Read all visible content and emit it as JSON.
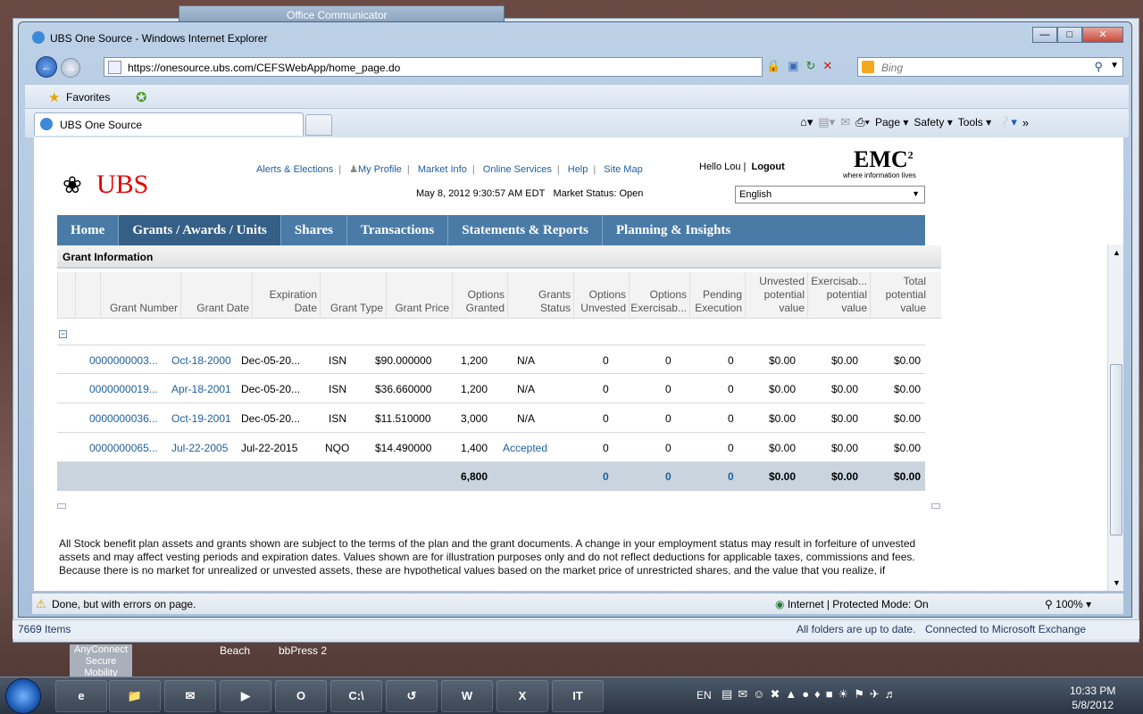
{
  "background_window": {
    "title": "Office Communicator",
    "status_left": "7669 Items",
    "status_mid": "All folders are up to date.",
    "status_right": "Connected to Microsoft Exchange"
  },
  "browser": {
    "title": "UBS One Source - Windows Internet Explorer",
    "url": "https://onesource.ubs.com/CEFSWebApp/home_page.do",
    "search_placeholder": "Bing",
    "favorites_label": "Favorites",
    "tab_label": "UBS One Source",
    "command_bar": [
      "Page",
      "Safety",
      "Tools"
    ],
    "status_message": "Done, but with errors on page.",
    "security_zone": "Internet | Protected Mode: On",
    "zoom": "100%"
  },
  "page": {
    "logo_text": "UBS",
    "top_links": [
      "Alerts & Elections",
      "My Profile",
      "Market Info",
      "Online Services",
      "Help",
      "Site Map"
    ],
    "datetime": "May 8, 2012 9:30:57 AM EDT",
    "market_status": "Market Status: Open",
    "hello": "Hello Lou |",
    "logout": "Logout",
    "emc_logo": "EMC",
    "emc_sup": "2",
    "emc_tagline": "where information lives",
    "language": "English",
    "nav": [
      "Home",
      "Grants / Awards / Units",
      "Shares",
      "Transactions",
      "Statements & Reports",
      "Planning & Insights"
    ],
    "active_nav": "Grants / Awards / Units",
    "section_title": "Grant Information",
    "columns": [
      "Grant Number",
      "Grant Date",
      "Expiration Date",
      "Grant Type",
      "Grant Price",
      "Options Granted",
      "Grants Status",
      "Options Unvested",
      "Options Exercisab...",
      "Pending Execution",
      "Unvested potential value",
      "Exercisab... potential value",
      "Total potential value"
    ],
    "rows": [
      [
        "0000000003...",
        "Oct-18-2000",
        "Dec-05-20...",
        "ISN",
        "$90.000000",
        "1,200",
        "N/A",
        "0",
        "0",
        "0",
        "$0.00",
        "$0.00",
        "$0.00"
      ],
      [
        "0000000019...",
        "Apr-18-2001",
        "Dec-05-20...",
        "ISN",
        "$36.660000",
        "1,200",
        "N/A",
        "0",
        "0",
        "0",
        "$0.00",
        "$0.00",
        "$0.00"
      ],
      [
        "0000000036...",
        "Oct-19-2001",
        "Dec-05-20...",
        "ISN",
        "$11.510000",
        "3,000",
        "N/A",
        "0",
        "0",
        "0",
        "$0.00",
        "$0.00",
        "$0.00"
      ],
      [
        "0000000065...",
        "Jul-22-2005",
        "Jul-22-2015",
        "NQO",
        "$14.490000",
        "1,400",
        "Accepted",
        "0",
        "0",
        "0",
        "$0.00",
        "$0.00",
        "$0.00"
      ]
    ],
    "totals": {
      "granted": "6,800",
      "unvested": "0",
      "exercisable": "0",
      "pending": "0",
      "unvested_value": "$0.00",
      "exercisable_value": "$0.00",
      "total_value": "$0.00"
    },
    "disclaimer": "All Stock benefit plan assets and grants shown are subject to the terms of the plan and the grant documents. A change in your employment status may result in forfeiture of unvested assets and may affect vesting periods and expiration dates. Values shown are for illustration purposes only and do not reflect deductions for applicable taxes, commissions and fees. Because there is no market for unrealized or unvested assets, these are hypothetical values based on the market price of unrestricted shares, and the value that you realize, if"
  },
  "desktop": {
    "labels": [
      "AnyConnect Secure Mobility",
      "Beach",
      "bbPress 2"
    ]
  },
  "taskbar": {
    "language": "EN",
    "time": "10:33 PM",
    "date": "5/8/2012"
  }
}
